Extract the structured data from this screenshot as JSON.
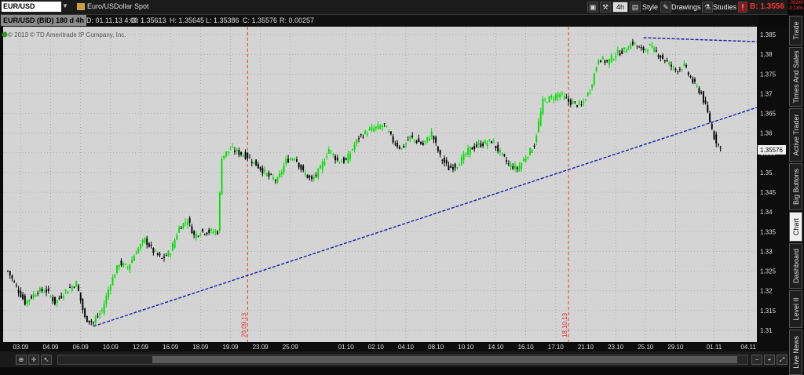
{
  "toolbar": {
    "symbol": "EUR/USD",
    "description": "Euro/USDollar Spot",
    "timeframe": "4h",
    "style_label": "Style",
    "drawings_label": "Drawings",
    "studies_label": "Studies",
    "bid_text": "B: 1.3556",
    "change_top": "-.00240",
    "change_bottom": "-0.18%"
  },
  "infobar": {
    "symbol_label": "EUR/USD (BID) 180 d 4h",
    "date": "D: 01.11.13 4:00",
    "open": "O: 1.35613",
    "high": "H: 1.35645",
    "low": "L: 1.35386",
    "close": "C: 1.35576",
    "range": "R: 0.00257",
    "copyright": "© 2013 © TD Ameritrade IP Company, Inc."
  },
  "side_tabs": [
    {
      "label": "Trade",
      "active": false
    },
    {
      "label": "Times And Sales",
      "active": false
    },
    {
      "label": "Active Trader",
      "active": false
    },
    {
      "label": "Big Buttons",
      "active": false
    },
    {
      "label": "Chart",
      "active": true
    },
    {
      "label": "Dashboard",
      "active": false
    },
    {
      "label": "Level II",
      "active": false
    },
    {
      "label": "Live News",
      "active": false
    }
  ],
  "chart_data": {
    "type": "candlestick",
    "title": "",
    "ylim": [
      1.307,
      1.387
    ],
    "y_ticks": [
      "1.385",
      "1.38",
      "1.375",
      "1.37",
      "1.365",
      "1.36",
      "1.355",
      "1.35",
      "1.345",
      "1.34",
      "1.335",
      "1.33",
      "1.325",
      "1.32",
      "1.315",
      "1.31"
    ],
    "y_tick_values": [
      1.385,
      1.38,
      1.375,
      1.37,
      1.365,
      1.36,
      1.355,
      1.35,
      1.345,
      1.34,
      1.335,
      1.33,
      1.325,
      1.32,
      1.315,
      1.31
    ],
    "x_ticks": [
      "03.09",
      "04.09",
      "06.09",
      "10.09",
      "12.09",
      "16.09",
      "18.09",
      "19.09",
      "23.09",
      "25.09",
      "01.10",
      "02.10",
      "04.10",
      "08.10",
      "10.10",
      "14.10",
      "16.10",
      "17.10",
      "21.10",
      "23.10",
      "25.10",
      "29.10",
      "01.11",
      "04.11"
    ],
    "x_tick_bars": [
      6,
      20,
      34,
      48,
      62,
      76,
      90,
      104,
      118,
      132,
      158,
      172,
      186,
      200,
      214,
      228,
      242,
      256,
      270,
      284,
      298,
      312,
      330,
      346
    ],
    "last_price": "1.35576",
    "vertical_markers": [
      {
        "label": "20.09.13",
        "bar": 112
      },
      {
        "label": "18.10.13",
        "bar": 262
      }
    ],
    "close_points": [
      [
        0,
        1.325
      ],
      [
        8,
        1.317
      ],
      [
        14,
        1.32
      ],
      [
        18,
        1.32
      ],
      [
        22,
        1.317
      ],
      [
        27,
        1.32
      ],
      [
        32,
        1.322
      ],
      [
        36,
        1.313
      ],
      [
        40,
        1.312
      ],
      [
        44,
        1.315
      ],
      [
        48,
        1.322
      ],
      [
        52,
        1.327
      ],
      [
        56,
        1.326
      ],
      [
        60,
        1.33
      ],
      [
        64,
        1.333
      ],
      [
        68,
        1.33
      ],
      [
        72,
        1.328
      ],
      [
        76,
        1.33
      ],
      [
        80,
        1.336
      ],
      [
        84,
        1.338
      ],
      [
        87,
        1.334
      ],
      [
        90,
        1.335
      ],
      [
        94,
        1.335
      ],
      [
        98,
        1.335
      ],
      [
        100,
        1.354
      ],
      [
        104,
        1.356
      ],
      [
        108,
        1.355
      ],
      [
        112,
        1.354
      ],
      [
        118,
        1.351
      ],
      [
        122,
        1.349
      ],
      [
        126,
        1.348
      ],
      [
        130,
        1.353
      ],
      [
        134,
        1.354
      ],
      [
        138,
        1.35
      ],
      [
        142,
        1.348
      ],
      [
        146,
        1.351
      ],
      [
        150,
        1.356
      ],
      [
        154,
        1.353
      ],
      [
        158,
        1.353
      ],
      [
        164,
        1.359
      ],
      [
        170,
        1.361
      ],
      [
        176,
        1.362
      ],
      [
        180,
        1.358
      ],
      [
        184,
        1.356
      ],
      [
        188,
        1.359
      ],
      [
        194,
        1.357
      ],
      [
        198,
        1.36
      ],
      [
        202,
        1.354
      ],
      [
        206,
        1.351
      ],
      [
        210,
        1.352
      ],
      [
        216,
        1.356
      ],
      [
        220,
        1.357
      ],
      [
        226,
        1.358
      ],
      [
        230,
        1.355
      ],
      [
        234,
        1.352
      ],
      [
        238,
        1.351
      ],
      [
        242,
        1.354
      ],
      [
        246,
        1.357
      ],
      [
        250,
        1.368
      ],
      [
        254,
        1.369
      ],
      [
        258,
        1.37
      ],
      [
        262,
        1.368
      ],
      [
        268,
        1.367
      ],
      [
        272,
        1.371
      ],
      [
        276,
        1.379
      ],
      [
        280,
        1.378
      ],
      [
        284,
        1.38
      ],
      [
        288,
        1.381
      ],
      [
        292,
        1.383
      ],
      [
        296,
        1.381
      ],
      [
        300,
        1.382
      ],
      [
        304,
        1.38
      ],
      [
        308,
        1.378
      ],
      [
        312,
        1.376
      ],
      [
        316,
        1.377
      ],
      [
        320,
        1.373
      ],
      [
        324,
        1.37
      ],
      [
        327,
        1.365
      ],
      [
        330,
        1.359
      ],
      [
        333,
        1.356
      ]
    ],
    "trendlines": [
      {
        "bar1": 40,
        "price1": 1.311,
        "bar2": 350,
        "price2": 1.3665,
        "style": "dashed"
      },
      {
        "bar1": 297,
        "price1": 1.3842,
        "bar2": 350,
        "price2": 1.3832,
        "style": "dashed"
      }
    ],
    "total_bars": 350,
    "colors": {
      "up": "#00e000",
      "down": "#000000",
      "background": "#d4d4d4",
      "grid": "#9a9a9a",
      "trendline": "#1a1aa8",
      "marker": "#e03030"
    },
    "grid": true
  }
}
